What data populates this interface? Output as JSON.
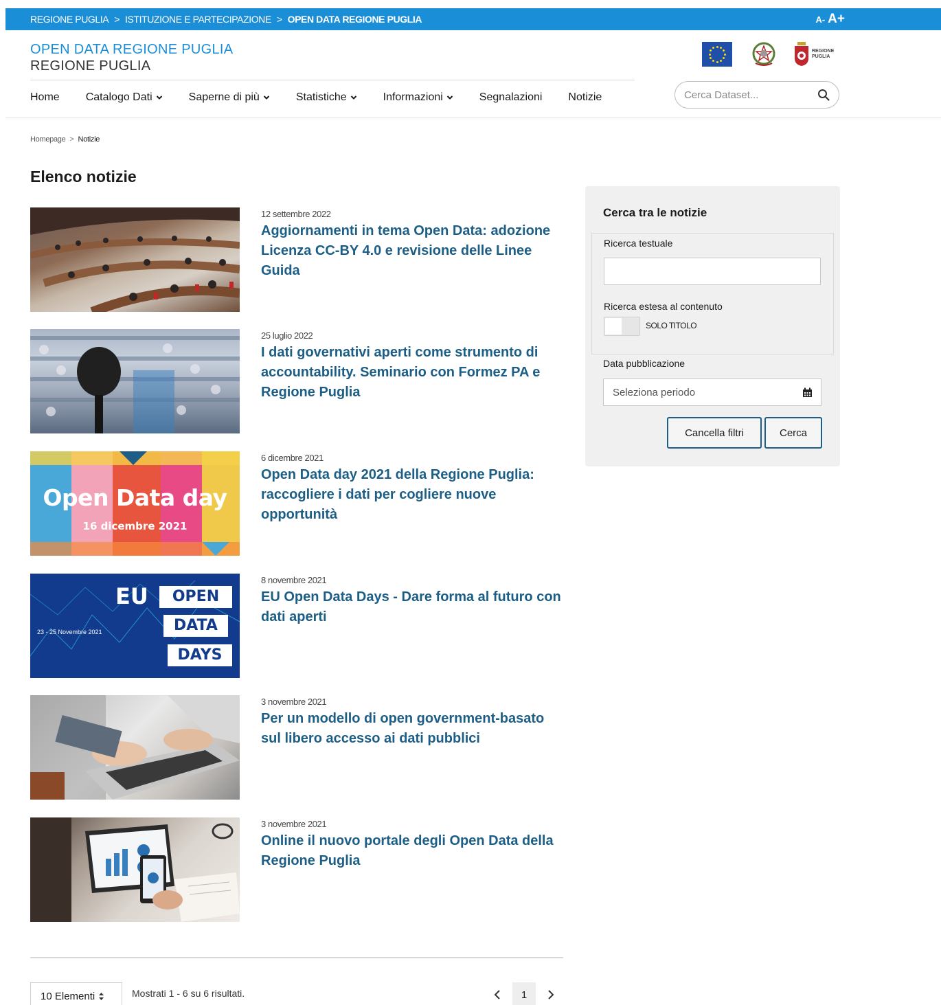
{
  "topbar": {
    "crumbs": [
      "REGIONE PUGLIA",
      "ISTITUZIONE E PARTECIPAZIONE",
      "OPEN DATA REGIONE PUGLIA"
    ],
    "separator": ">",
    "font_small": "A-",
    "font_big": "A+",
    "color": "#1a8fd8"
  },
  "header": {
    "title": "OPEN DATA REGIONE PUGLIA",
    "subtitle": "REGIONE PUGLIA",
    "puglia_logo_text": [
      "REGIONE",
      "PUGLIA"
    ]
  },
  "nav": {
    "items": [
      {
        "label": "Home",
        "dropdown": false
      },
      {
        "label": "Catalogo Dati",
        "dropdown": true
      },
      {
        "label": "Saperne di più",
        "dropdown": true
      },
      {
        "label": "Statistiche",
        "dropdown": true
      },
      {
        "label": "Informazioni",
        "dropdown": true
      },
      {
        "label": "Segnalazioni",
        "dropdown": false
      },
      {
        "label": "Notizie",
        "dropdown": false
      }
    ],
    "search_placeholder": "Cerca Dataset..."
  },
  "breadcrumb": {
    "home": "Homepage",
    "separator": ">",
    "current": "Notizie"
  },
  "page": {
    "title": "Elenco notizie"
  },
  "news": [
    {
      "date": "12 settembre 2022",
      "title": "Aggiornamenti in tema Open Data: adozione Licenza CC-BY 4.0 e revisione delle Linee Guida"
    },
    {
      "date": "25 luglio 2022",
      "title": "I dati governativi aperti come strumento di accountability. Seminario con Formez PA e Regione Puglia"
    },
    {
      "date": "6 dicembre 2021",
      "title": "Open Data day 2021 della Regione Puglia: raccogliere i dati per cogliere nuove opportunità",
      "image_text": {
        "line1": "Open Data day",
        "line2": "16 dicembre 2021"
      }
    },
    {
      "date": "8 novembre 2021",
      "title": "EU Open Data Days - Dare forma al futuro con dati aperti",
      "image_text": {
        "eu": "EU",
        "open": "OPEN",
        "data": "DATA",
        "days": "DAYS",
        "dates": "23 - 25 Novembre 2021"
      }
    },
    {
      "date": "3 novembre 2021",
      "title": "Per un modello di open government-basato sul libero accesso ai dati pubblici"
    },
    {
      "date": "3 novembre 2021",
      "title": "Online il nuovo portale degli Open Data della Regione Puglia"
    }
  ],
  "filters": {
    "title": "Cerca tra le notizie",
    "text_search_label": "Ricerca testuale",
    "text_search_value": "",
    "extended_label": "Ricerca estesa al contenuto",
    "toggle_label": "SOLO TITOLO",
    "date_label": "Data pubblicazione",
    "date_placeholder": "Seleziona periodo",
    "clear_button": "Cancella filtri",
    "search_button": "Cerca"
  },
  "pagination": {
    "per_page": "10 Elementi",
    "results": "Mostrati 1 - 6 su 6 risultati.",
    "current_page": "1"
  }
}
